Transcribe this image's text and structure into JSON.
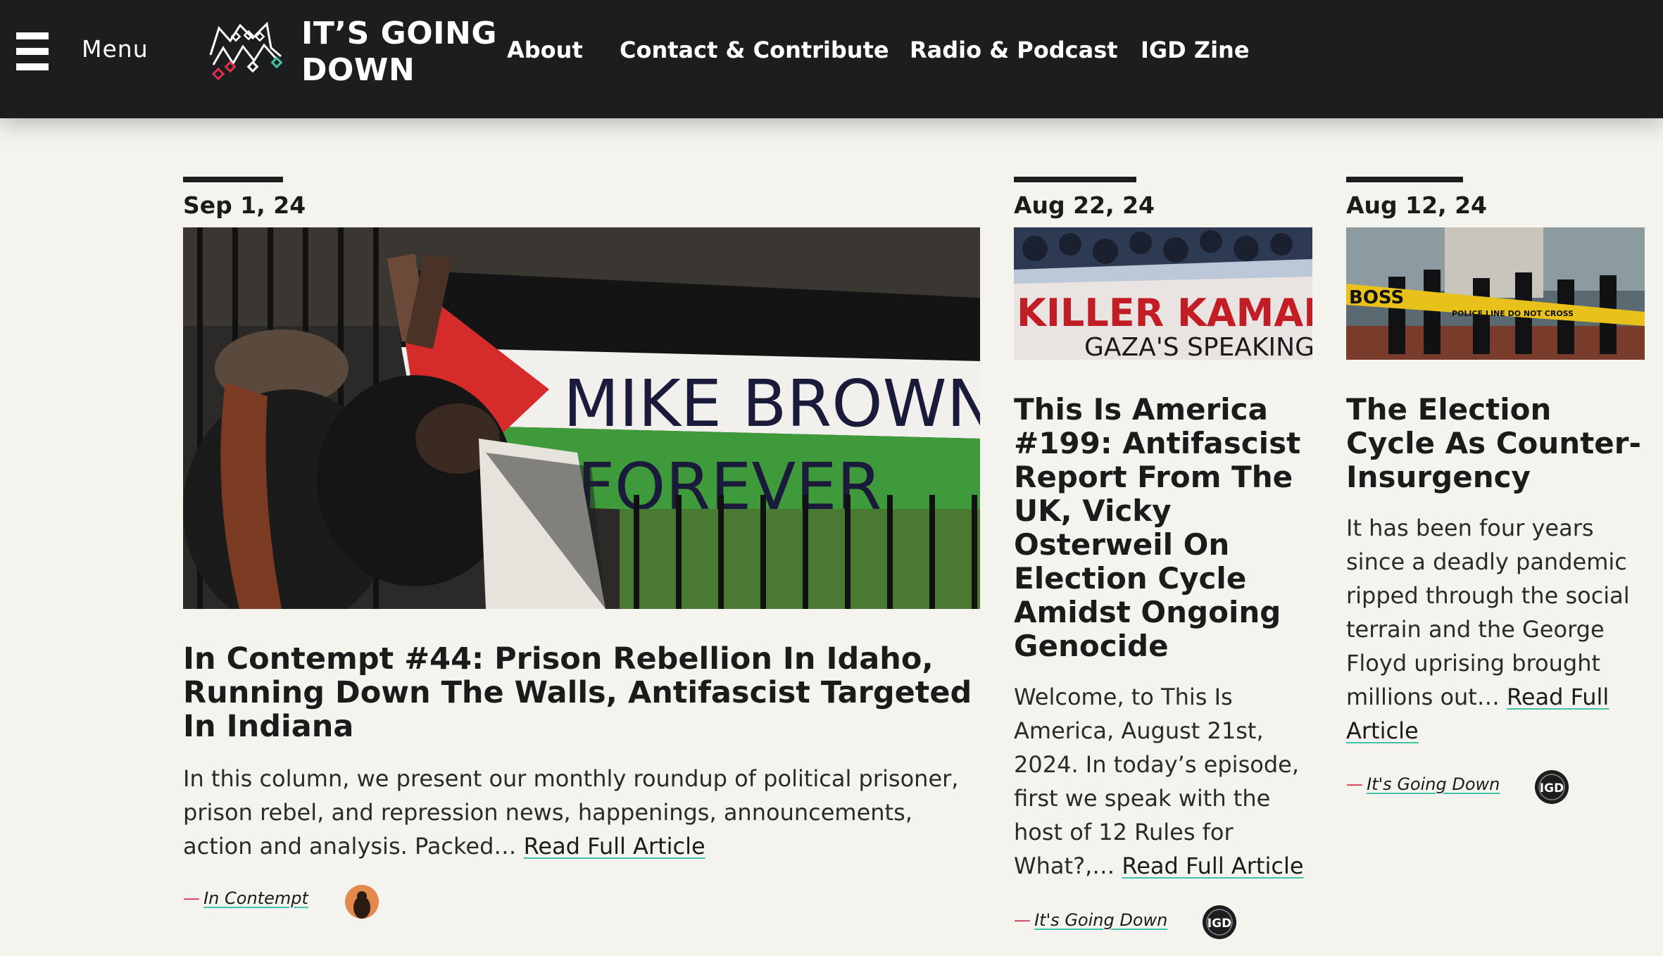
{
  "header": {
    "menu_label": "Menu",
    "logo_line1": "IT’S GOING",
    "logo_line2": "DOWN",
    "nav": [
      "About",
      "Contact & Contribute",
      "Radio & Podcast",
      "IGD Zine"
    ]
  },
  "articles": [
    {
      "date": "Sep 1, 24",
      "image_text_1": "MIKE BROWN",
      "image_text_2": "FOREVER",
      "title": "In Contempt #44: Prison Rebellion In Idaho, Running Down The Walls, Antifascist Targeted In Indiana",
      "excerpt": "In this column, we present our monthly roundup of political prisoner, prison rebel, and repression news, happenings, announcements, action and analysis. Packed…",
      "read_more": "Read Full Article",
      "dash": "—",
      "author": "In Contempt"
    },
    {
      "date": "Aug 22, 24",
      "image_text_1": "KILLER KAMALA",
      "image_text_2": "GAZA'S SPEAKING",
      "title": "This Is America #199: Antifascist Report From The UK, Vicky Osterweil On Election Cycle Amidst Ongoing Genocide",
      "excerpt": "Welcome, to This Is America, August 21st, 2024. In today’s episode, first we speak with the host of 12 Rules for What?,…",
      "read_more": "Read Full Article",
      "dash": "—",
      "author": "It's Going Down",
      "avatar_text": "IGD"
    },
    {
      "date": "Aug 12, 24",
      "image_text_1": "BOSS",
      "image_text_2": "POLICE LINE DO NOT CROSS",
      "title": "The Election Cycle As Counter-Insurgency",
      "excerpt": "It has been four years since a deadly pandemic ripped through the social terrain and the George Floyd uprising brought millions out…",
      "read_more": "Read Full Article",
      "dash": "—",
      "author": "It's Going Down",
      "avatar_text": "IGD"
    }
  ],
  "colors": {
    "header_bg": "#1b1d1e",
    "page_bg": "#f5f3ee",
    "link_underline": "#3fc4a7",
    "byline_dash": "#d2364f"
  }
}
